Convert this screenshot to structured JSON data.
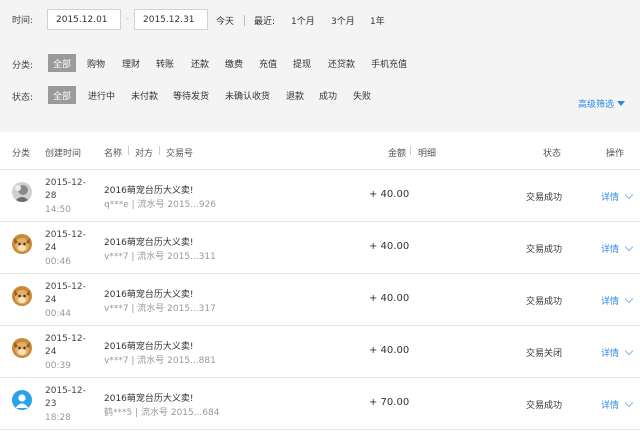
{
  "filters": {
    "time_label": "时间:",
    "date_start": "2015.12.01",
    "date_sep": "-",
    "date_end": "2015.12.31",
    "today": "今天",
    "recent_label": "最近:",
    "ranges": [
      "1个月",
      "3个月",
      "1年"
    ],
    "category_label": "分类:",
    "categories": [
      "全部",
      "购物",
      "理财",
      "转账",
      "还款",
      "缴费",
      "充值",
      "提现",
      "还贷款",
      "手机充值"
    ],
    "status_label": "状态:",
    "statuses": [
      "全部",
      "进行中",
      "未付款",
      "等待发货",
      "未确认收货",
      "退款",
      "成功",
      "失败"
    ],
    "advanced": "高级筛选"
  },
  "table": {
    "headers": {
      "category": "分类",
      "created": "创建时间",
      "name": "名称",
      "party": "对方",
      "txn": "交易号",
      "amount": "金额",
      "detail_col": "明细",
      "status": "状态",
      "action": "操作"
    },
    "rows": [
      {
        "avatar": "avatar-gray-photo",
        "date": "2015-12-",
        "day": "28",
        "time": "14:50",
        "title": "2016萌宠台历大义卖!",
        "sub": "q***e | 流水号 2015...926",
        "amount": "+ 40.00",
        "status": "交易成功",
        "action": "详情"
      },
      {
        "avatar": "avatar-dog-photo",
        "date": "2015-12-",
        "day": "24",
        "time": "00:46",
        "title": "2016萌宠台历大义卖!",
        "sub": "v***7 | 流水号 2015...311",
        "amount": "+ 40.00",
        "status": "交易成功",
        "action": "详情"
      },
      {
        "avatar": "avatar-dog-photo",
        "date": "2015-12-",
        "day": "24",
        "time": "00:44",
        "title": "2016萌宠台历大义卖!",
        "sub": "v***7 | 流水号 2015...317",
        "amount": "+ 40.00",
        "status": "交易成功",
        "action": "详情"
      },
      {
        "avatar": "avatar-dog-photo",
        "date": "2015-12-",
        "day": "24",
        "time": "00:39",
        "title": "2016萌宠台历大义卖!",
        "sub": "v***7 | 流水号 2015...881",
        "amount": "+ 40.00",
        "status": "交易关闭",
        "action": "详情"
      },
      {
        "avatar": "avatar-default-user",
        "date": "2015-12-",
        "day": "23",
        "time": "18:28",
        "title": "2016萌宠台历大义卖!",
        "sub": "鹤***5 | 流水号 2015...684",
        "amount": "+ 70.00",
        "status": "交易成功",
        "action": "详情"
      }
    ]
  },
  "colors": {
    "accent": "#2a8be8",
    "chip_active": "#9a9a9a",
    "filter_bg": "#f4f4f4"
  }
}
